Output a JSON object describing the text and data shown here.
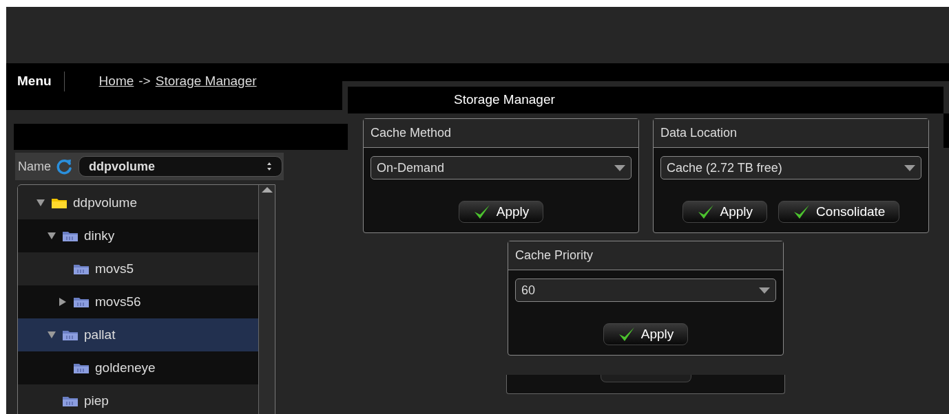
{
  "header": {
    "menu": "Menu",
    "breadcrumb": [
      {
        "label": "Home"
      },
      {
        "label": "Storage Manager"
      }
    ],
    "separator": "->"
  },
  "title": "Storage Manager",
  "volume_selector": {
    "label": "Name",
    "value": "ddpvolume"
  },
  "tree": [
    {
      "label": "ddpvolume",
      "kind": "volume",
      "expanded": true,
      "selected": false,
      "children": [
        {
          "label": "dinky",
          "kind": "folder",
          "expanded": true,
          "selected": false,
          "children": [
            {
              "label": "movs5",
              "kind": "folder",
              "selected": false
            },
            {
              "label": "movs56",
              "kind": "folder",
              "expanded": false,
              "selected": false
            }
          ]
        },
        {
          "label": "pallat",
          "kind": "folder",
          "expanded": true,
          "selected": true,
          "children": [
            {
              "label": "goldeneye",
              "kind": "folder",
              "selected": false
            }
          ]
        },
        {
          "label": "piep",
          "kind": "folder",
          "selected": false
        }
      ]
    }
  ],
  "panels": [
    {
      "title": "Cache Method",
      "value": "On-Demand",
      "buttons": [
        "Apply"
      ]
    },
    {
      "title": "Data Location",
      "value": "Cache (2.72 TB free)",
      "buttons": [
        "Apply",
        "Consolidate"
      ]
    },
    {
      "title": "Cache Priority",
      "value": "60",
      "buttons": [
        "Apply"
      ]
    }
  ]
}
